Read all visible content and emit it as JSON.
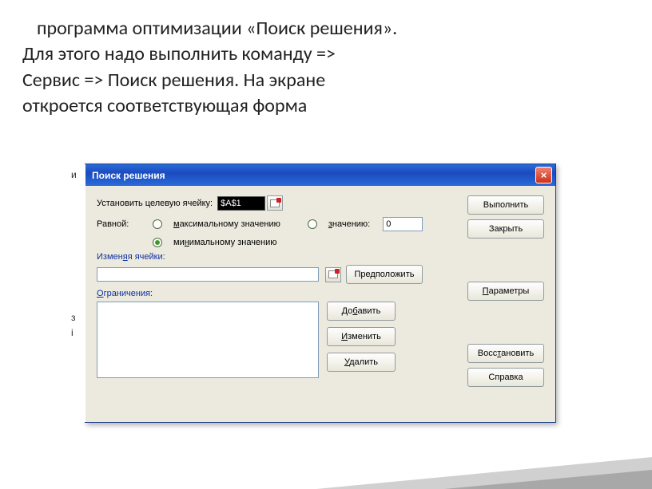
{
  "heading": {
    "line1": "программа оптимизации «Поиск решения».",
    "line2": "Для этого надо выполнить команду =>",
    "line3": "Сервис => Поиск решения. На экране",
    "line4": "откроется соответствующая форма"
  },
  "dialog": {
    "title": "Поиск решения",
    "target_label": "Установить целевую ячейку:",
    "target_value": "$A$1",
    "equal_label": "Равной:",
    "radio_max": "максимальному значению",
    "radio_value": "значению:",
    "radio_min": "минимальному значению",
    "value_field": "0",
    "changing_label": "Изменяя ячейки:",
    "changing_value": "",
    "guess_btn": "Предположить",
    "constraints_label": "Ограничения:",
    "add_btn": "Добавить",
    "change_btn": "Изменить",
    "delete_btn": "Удалить",
    "run_btn": "Выполнить",
    "close_btn": "Закрыть",
    "params_btn": "Параметры",
    "restore_btn": "Восстановить",
    "help_btn": "Справка"
  }
}
